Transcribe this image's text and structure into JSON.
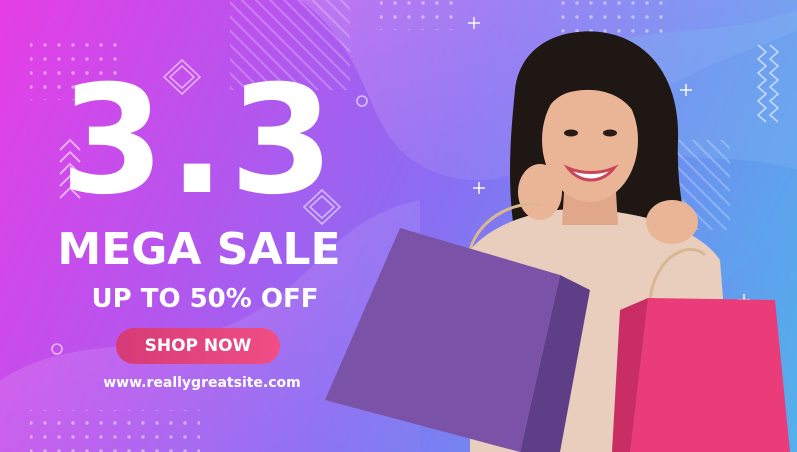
{
  "banner": {
    "headline": "3.3",
    "subheadline": "MEGA SALE",
    "offer": "UP TO 50% OFF",
    "cta_label": "SHOP NOW",
    "website": "www.reallygreatsite.com"
  },
  "colors": {
    "gradient_start": "#e63ee6",
    "gradient_mid": "#8a6df2",
    "gradient_end": "#4fb7ea",
    "cta": "#e4457d",
    "bag_purple": "#7a53a8",
    "bag_pink": "#e93c78"
  },
  "icons": [
    "chevron-stack-icon",
    "diamond-outline-icon",
    "plus-icon",
    "circle-outline-icon",
    "zigzag-icon",
    "dot-grid-icon"
  ]
}
